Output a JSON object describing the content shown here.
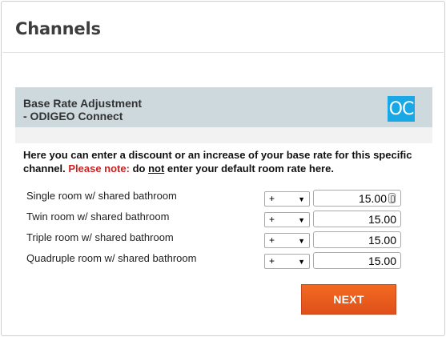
{
  "page": {
    "title": "Channels"
  },
  "panel": {
    "title_line1": "Base Rate Adjustment",
    "title_line2": "- ODIGEO Connect",
    "logo_text": "OC",
    "logo_color": "#1aa7e6",
    "header_color": "#cdd9dc"
  },
  "intro": {
    "text_before": "Here you can enter a discount or an increase of your base rate for this specific channel. ",
    "note_label": "Please note:",
    "text_middle": " do ",
    "emphasis": "not",
    "text_after": " enter your default room rate here.",
    "note_color": "#d21e1e"
  },
  "rates": [
    {
      "room": "Single room w/ shared bathroom",
      "operator": "+",
      "value": "15.00"
    },
    {
      "room": "Twin room w/ shared bathroom",
      "operator": "+",
      "value": "15.00"
    },
    {
      "room": "Triple room w/ shared bathroom",
      "operator": "+",
      "value": "15.00"
    },
    {
      "room": "Quadruple room w/ shared bathroom",
      "operator": "+",
      "value": "15.00"
    }
  ],
  "actions": {
    "next_label": "NEXT",
    "next_color": "#f26a21"
  }
}
